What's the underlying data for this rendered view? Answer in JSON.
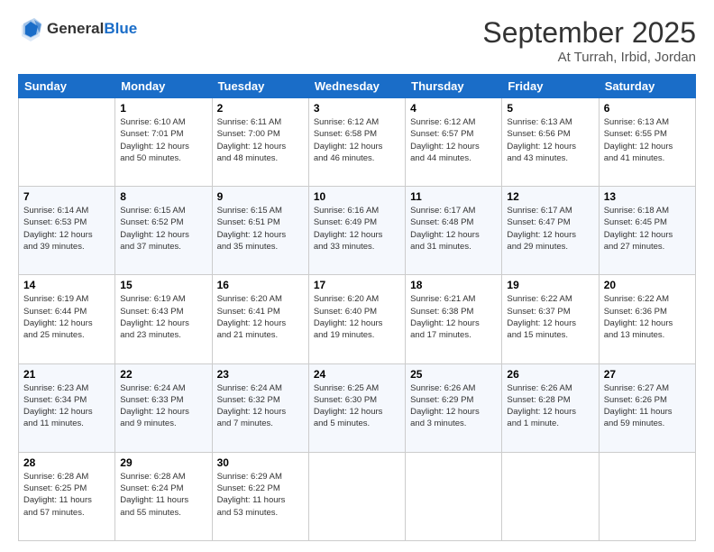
{
  "header": {
    "logo_general": "General",
    "logo_blue": "Blue",
    "month_title": "September 2025",
    "subtitle": "At Turrah, Irbid, Jordan"
  },
  "days_of_week": [
    "Sunday",
    "Monday",
    "Tuesday",
    "Wednesday",
    "Thursday",
    "Friday",
    "Saturday"
  ],
  "weeks": [
    [
      {
        "day": "",
        "info": ""
      },
      {
        "day": "1",
        "info": "Sunrise: 6:10 AM\nSunset: 7:01 PM\nDaylight: 12 hours\nand 50 minutes."
      },
      {
        "day": "2",
        "info": "Sunrise: 6:11 AM\nSunset: 7:00 PM\nDaylight: 12 hours\nand 48 minutes."
      },
      {
        "day": "3",
        "info": "Sunrise: 6:12 AM\nSunset: 6:58 PM\nDaylight: 12 hours\nand 46 minutes."
      },
      {
        "day": "4",
        "info": "Sunrise: 6:12 AM\nSunset: 6:57 PM\nDaylight: 12 hours\nand 44 minutes."
      },
      {
        "day": "5",
        "info": "Sunrise: 6:13 AM\nSunset: 6:56 PM\nDaylight: 12 hours\nand 43 minutes."
      },
      {
        "day": "6",
        "info": "Sunrise: 6:13 AM\nSunset: 6:55 PM\nDaylight: 12 hours\nand 41 minutes."
      }
    ],
    [
      {
        "day": "7",
        "info": "Sunrise: 6:14 AM\nSunset: 6:53 PM\nDaylight: 12 hours\nand 39 minutes."
      },
      {
        "day": "8",
        "info": "Sunrise: 6:15 AM\nSunset: 6:52 PM\nDaylight: 12 hours\nand 37 minutes."
      },
      {
        "day": "9",
        "info": "Sunrise: 6:15 AM\nSunset: 6:51 PM\nDaylight: 12 hours\nand 35 minutes."
      },
      {
        "day": "10",
        "info": "Sunrise: 6:16 AM\nSunset: 6:49 PM\nDaylight: 12 hours\nand 33 minutes."
      },
      {
        "day": "11",
        "info": "Sunrise: 6:17 AM\nSunset: 6:48 PM\nDaylight: 12 hours\nand 31 minutes."
      },
      {
        "day": "12",
        "info": "Sunrise: 6:17 AM\nSunset: 6:47 PM\nDaylight: 12 hours\nand 29 minutes."
      },
      {
        "day": "13",
        "info": "Sunrise: 6:18 AM\nSunset: 6:45 PM\nDaylight: 12 hours\nand 27 minutes."
      }
    ],
    [
      {
        "day": "14",
        "info": "Sunrise: 6:19 AM\nSunset: 6:44 PM\nDaylight: 12 hours\nand 25 minutes."
      },
      {
        "day": "15",
        "info": "Sunrise: 6:19 AM\nSunset: 6:43 PM\nDaylight: 12 hours\nand 23 minutes."
      },
      {
        "day": "16",
        "info": "Sunrise: 6:20 AM\nSunset: 6:41 PM\nDaylight: 12 hours\nand 21 minutes."
      },
      {
        "day": "17",
        "info": "Sunrise: 6:20 AM\nSunset: 6:40 PM\nDaylight: 12 hours\nand 19 minutes."
      },
      {
        "day": "18",
        "info": "Sunrise: 6:21 AM\nSunset: 6:38 PM\nDaylight: 12 hours\nand 17 minutes."
      },
      {
        "day": "19",
        "info": "Sunrise: 6:22 AM\nSunset: 6:37 PM\nDaylight: 12 hours\nand 15 minutes."
      },
      {
        "day": "20",
        "info": "Sunrise: 6:22 AM\nSunset: 6:36 PM\nDaylight: 12 hours\nand 13 minutes."
      }
    ],
    [
      {
        "day": "21",
        "info": "Sunrise: 6:23 AM\nSunset: 6:34 PM\nDaylight: 12 hours\nand 11 minutes."
      },
      {
        "day": "22",
        "info": "Sunrise: 6:24 AM\nSunset: 6:33 PM\nDaylight: 12 hours\nand 9 minutes."
      },
      {
        "day": "23",
        "info": "Sunrise: 6:24 AM\nSunset: 6:32 PM\nDaylight: 12 hours\nand 7 minutes."
      },
      {
        "day": "24",
        "info": "Sunrise: 6:25 AM\nSunset: 6:30 PM\nDaylight: 12 hours\nand 5 minutes."
      },
      {
        "day": "25",
        "info": "Sunrise: 6:26 AM\nSunset: 6:29 PM\nDaylight: 12 hours\nand 3 minutes."
      },
      {
        "day": "26",
        "info": "Sunrise: 6:26 AM\nSunset: 6:28 PM\nDaylight: 12 hours\nand 1 minute."
      },
      {
        "day": "27",
        "info": "Sunrise: 6:27 AM\nSunset: 6:26 PM\nDaylight: 11 hours\nand 59 minutes."
      }
    ],
    [
      {
        "day": "28",
        "info": "Sunrise: 6:28 AM\nSunset: 6:25 PM\nDaylight: 11 hours\nand 57 minutes."
      },
      {
        "day": "29",
        "info": "Sunrise: 6:28 AM\nSunset: 6:24 PM\nDaylight: 11 hours\nand 55 minutes."
      },
      {
        "day": "30",
        "info": "Sunrise: 6:29 AM\nSunset: 6:22 PM\nDaylight: 11 hours\nand 53 minutes."
      },
      {
        "day": "",
        "info": ""
      },
      {
        "day": "",
        "info": ""
      },
      {
        "day": "",
        "info": ""
      },
      {
        "day": "",
        "info": ""
      }
    ]
  ]
}
